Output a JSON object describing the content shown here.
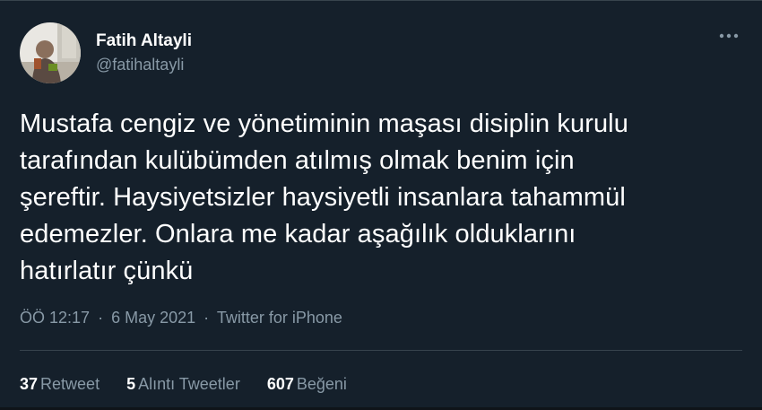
{
  "colors": {
    "background": "#15202b",
    "primary_text": "#ffffff",
    "secondary_text": "#8899a6",
    "border": "#38444d"
  },
  "author": {
    "name": "Fatih Altayli",
    "handle": "@fatihaltayli",
    "avatar_icon": "profile-photo"
  },
  "more_icon": "more-horizontal-icon",
  "tweet": {
    "lines": [
      "Mustafa cengiz ve yönetiminin maşası disiplin kurulu",
      "tarafından kulübümden atılmış olmak benim için",
      "şereftir. Haysiyetsizler haysiyetli insanlara tahammül",
      "edemezler. Onlara me kadar aşağılık olduklarını",
      "hatırlatır çünkü"
    ]
  },
  "meta": {
    "time": "ÖÖ 12:17",
    "separator": "·",
    "date": "6 May 2021",
    "source": "Twitter for iPhone"
  },
  "stats": {
    "retweets": {
      "count": "37",
      "label": "Retweet"
    },
    "quotes": {
      "count": "5",
      "label": "Alıntı Tweetler"
    },
    "likes": {
      "count": "607",
      "label": "Beğeni"
    }
  }
}
